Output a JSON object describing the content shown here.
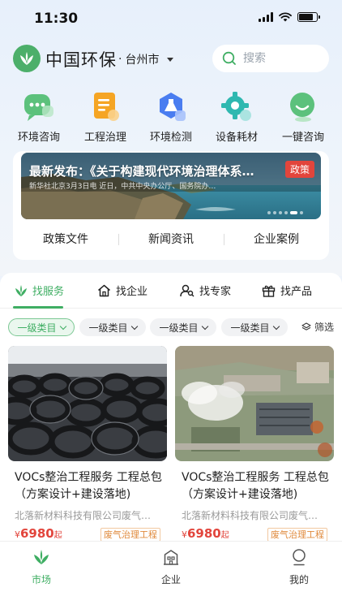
{
  "status": {
    "time": "11:30"
  },
  "header": {
    "app_title": "中国环保",
    "city": "台州市",
    "search_placeholder": "搜索"
  },
  "quick_actions": [
    {
      "label": "环境咨询",
      "icon": "chat-bubble-icon"
    },
    {
      "label": "工程治理",
      "icon": "document-icon"
    },
    {
      "label": "环境检测",
      "icon": "flask-icon"
    },
    {
      "label": "设备耗材",
      "icon": "gear-icon"
    },
    {
      "label": "一键咨询",
      "icon": "smile-chat-icon"
    }
  ],
  "banner": {
    "title": "最新发布：《关于构建现代环境治理体系…",
    "subtitle": "新华社北京3月3日电 近日，中共中央办公厅、国务院办…",
    "tag": "政策",
    "tabs": [
      "政策文件",
      "新闻资讯",
      "企业案例"
    ]
  },
  "main_tabs": [
    {
      "label": "找服务",
      "icon": "leaf-icon"
    },
    {
      "label": "找企业",
      "icon": "home-icon"
    },
    {
      "label": "找专家",
      "icon": "user-search-icon"
    },
    {
      "label": "找产品",
      "icon": "gift-icon"
    }
  ],
  "filters": [
    "一级类目",
    "一级类目",
    "一级类目",
    "一级类目"
  ],
  "filter_button": "筛选",
  "cards": [
    {
      "title": "VOCs整治工程服务 工程总包（方案设计+建设落地)",
      "company": "北落新材料科技有限公司废气…",
      "price_symbol": "¥",
      "price": "6980",
      "price_unit": "起",
      "tag": "废气治理工程"
    },
    {
      "title": "VOCs整治工程服务 工程总包（方案设计+建设落地)",
      "company": "北落新材料科技有限公司废气…",
      "price_symbol": "¥",
      "price": "6980",
      "price_unit": "起",
      "tag": "废气治理工程"
    }
  ],
  "bottom_nav": [
    {
      "label": "市场",
      "icon": "leaf-icon"
    },
    {
      "label": "企业",
      "icon": "building-icon"
    },
    {
      "label": "我的",
      "icon": "profile-icon"
    }
  ],
  "colors": {
    "accent": "#3fae63",
    "price": "#e2453c",
    "tag": "#e08a3c"
  }
}
